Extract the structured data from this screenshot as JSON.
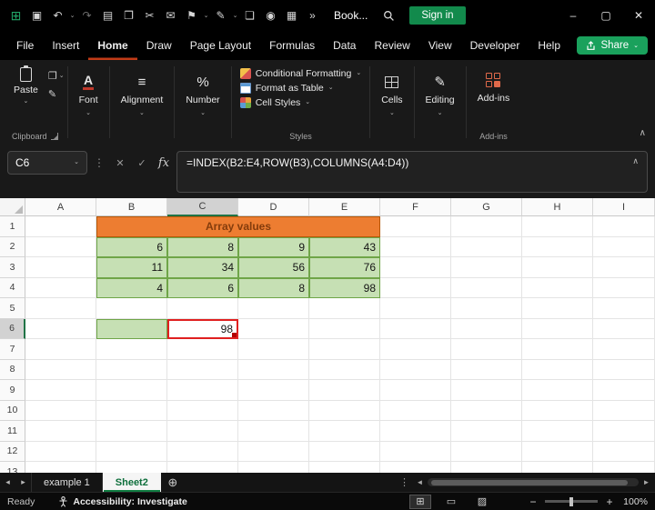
{
  "colors": {
    "accent_green": "#217346",
    "share_green": "#1AA15C",
    "signin_green": "#128A4C",
    "menu_underline_red": "#C23B17",
    "header_fill_orange": "#ED7D31",
    "header_text_brown": "#843C0C",
    "table_fill_green": "#C6E0B4",
    "table_border_green": "#6FA548",
    "selection_red": "#E02020",
    "addins_red": "#E0694A"
  },
  "glyphs": {
    "caret_down": "⌄",
    "chevron_up": "∧",
    "ellipsis_v": "⋮",
    "cancel": "✕",
    "confirm": "✓",
    "fx": "fx",
    "minimize": "–",
    "maximize": "▢",
    "close": "✕",
    "plus_circle": "⊕",
    "nav_left": "◂",
    "nav_right": "▸",
    "scroll_left": "◄",
    "scroll_right": "►",
    "zoom_out": "−",
    "zoom_in": "+",
    "alignment": "≡",
    "number": "%",
    "editing": "✎",
    "font_letter": "A"
  },
  "titlebar": {
    "icons": [
      {
        "name": "excel-app-icon",
        "glyph": "⊞"
      },
      {
        "name": "save-icon",
        "glyph": "▣"
      },
      {
        "name": "undo-icon",
        "glyph": "↶"
      },
      {
        "name": "redo-icon",
        "glyph": "↷"
      },
      {
        "name": "paste-icon",
        "glyph": "▤"
      },
      {
        "name": "copy-icon",
        "glyph": "❐"
      },
      {
        "name": "cut-icon",
        "glyph": "✂"
      },
      {
        "name": "mail-icon",
        "glyph": "✉"
      },
      {
        "name": "flag-icon",
        "glyph": "⚑"
      },
      {
        "name": "pen-icon",
        "glyph": "✎"
      },
      {
        "name": "document-icon",
        "glyph": "❏"
      },
      {
        "name": "camera-icon",
        "glyph": "◉"
      },
      {
        "name": "table-icon",
        "glyph": "▦"
      },
      {
        "name": "overflow-icon",
        "glyph": "»"
      }
    ],
    "workbook_name": "Book...",
    "signin_label": "Sign in"
  },
  "menubar": {
    "items": [
      "File",
      "Insert",
      "Home",
      "Draw",
      "Page Layout",
      "Formulas",
      "Data",
      "Review",
      "View",
      "Developer",
      "Help"
    ],
    "active_item": "Home",
    "share_label": "Share"
  },
  "ribbon": {
    "paste_label": "Paste",
    "clipboard_group_label": "Clipboard",
    "font_label": "Font",
    "alignment_label": "Alignment",
    "number_label": "Number",
    "styles": {
      "conditional_formatting_label": "Conditional Formatting",
      "format_as_table_label": "Format as Table",
      "cell_styles_label": "Cell Styles",
      "group_label": "Styles"
    },
    "cells_label": "Cells",
    "editing_label": "Editing",
    "addins_label": "Add-ins",
    "addins_group_label": "Add-ins"
  },
  "formula_bar": {
    "name_box": "C6",
    "formula": "=INDEX(B2:E4,ROW(B3),COLUMNS(A4:D4))"
  },
  "grid": {
    "columns": [
      "A",
      "B",
      "C",
      "D",
      "E",
      "F",
      "G",
      "H",
      "I"
    ],
    "row_count": 13,
    "selected_column": "C",
    "selected_row": 6,
    "merged": {
      "row": 1,
      "start_col": "B",
      "span": 4,
      "text": "Array values"
    },
    "values": {
      "B2": "6",
      "C2": "8",
      "D2": "9",
      "E2": "43",
      "B3": "11",
      "C3": "34",
      "D3": "56",
      "E3": "76",
      "B4": "4",
      "C4": "6",
      "D4": "8",
      "E4": "98"
    },
    "green_empty": [
      "B6"
    ],
    "selected_cell": {
      "ref": "C6",
      "value": "98"
    }
  },
  "sheet_tabs": {
    "tabs": [
      {
        "label": "example 1",
        "active": false
      },
      {
        "label": "Sheet2",
        "active": true
      }
    ]
  },
  "status_bar": {
    "mode": "Ready",
    "accessibility": "Accessibility: Investigate",
    "view_icons": [
      {
        "name": "normal-view",
        "glyph": "⊞"
      },
      {
        "name": "page-layout-view",
        "glyph": "▭"
      },
      {
        "name": "page-break-view",
        "glyph": "▨"
      }
    ],
    "zoom_level": "100%"
  }
}
